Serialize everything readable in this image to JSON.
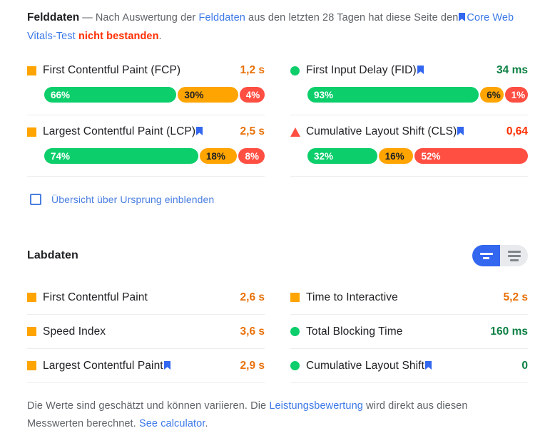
{
  "field_section": {
    "title": "Felddaten",
    "dash": "—",
    "sentence_part1": "Nach Auswertung der",
    "link1": "Felddaten",
    "sentence_part2": "aus den letzten 28 Tagen hat diese Seite den",
    "link2": "Core Web Vitals-Test",
    "fail_text": "nicht bestanden",
    "period": ".",
    "bookmark_icon": "bookmark-icon",
    "metrics": [
      {
        "id": "fcp",
        "label": "First Contentful Paint (FCP)",
        "value": "1,2 s",
        "status": "average",
        "glyph": "square-icon",
        "has_bookmark": false,
        "distribution": [
          {
            "label": "66%",
            "pct": 66,
            "band": "good"
          },
          {
            "label": "30%",
            "pct": 30,
            "band": "average"
          },
          {
            "label": "4%",
            "pct": 4,
            "band": "poor"
          }
        ]
      },
      {
        "id": "fid",
        "label": "First Input Delay (FID)",
        "value": "34 ms",
        "status": "good",
        "glyph": "circle-icon",
        "has_bookmark": true,
        "distribution": [
          {
            "label": "93%",
            "pct": 93,
            "band": "good"
          },
          {
            "label": "6%",
            "pct": 6,
            "band": "average"
          },
          {
            "label": "1%",
            "pct": 1,
            "band": "poor"
          }
        ]
      },
      {
        "id": "lcp",
        "label": "Largest Contentful Paint (LCP)",
        "value": "2,5 s",
        "status": "average",
        "glyph": "square-icon",
        "has_bookmark": true,
        "distribution": [
          {
            "label": "74%",
            "pct": 74,
            "band": "good"
          },
          {
            "label": "18%",
            "pct": 18,
            "band": "average"
          },
          {
            "label": "8%",
            "pct": 8,
            "band": "poor"
          }
        ]
      },
      {
        "id": "cls",
        "label": "Cumulative Layout Shift (CLS)",
        "value": "0,64",
        "status": "poor",
        "glyph": "triangle-icon",
        "has_bookmark": true,
        "distribution": [
          {
            "label": "32%",
            "pct": 32,
            "band": "good"
          },
          {
            "label": "16%",
            "pct": 16,
            "band": "average"
          },
          {
            "label": "52%",
            "pct": 52,
            "band": "poor"
          }
        ]
      }
    ],
    "origin_checkbox": {
      "label": "Übersicht über Ursprung einblenden",
      "checked": false
    }
  },
  "lab_section": {
    "title": "Labdaten",
    "view_toggle": {
      "active": "compact-view",
      "options": [
        {
          "id": "compact-view",
          "icon": "compact-list-icon",
          "active": true
        },
        {
          "id": "detailed-view",
          "icon": "detailed-list-icon",
          "active": false
        }
      ]
    },
    "metrics": [
      {
        "id": "fcp",
        "label": "First Contentful Paint",
        "value": "2,6 s",
        "status": "average",
        "glyph": "square-icon",
        "has_bookmark": false
      },
      {
        "id": "tti",
        "label": "Time to Interactive",
        "value": "5,2 s",
        "status": "average",
        "glyph": "square-icon",
        "has_bookmark": false
      },
      {
        "id": "si",
        "label": "Speed Index",
        "value": "3,6 s",
        "status": "average",
        "glyph": "square-icon",
        "has_bookmark": false
      },
      {
        "id": "tbt",
        "label": "Total Blocking Time",
        "value": "160 ms",
        "status": "good",
        "glyph": "circle-icon",
        "has_bookmark": false
      },
      {
        "id": "lcp",
        "label": "Largest Contentful Paint",
        "value": "2,9 s",
        "status": "average",
        "glyph": "square-icon",
        "has_bookmark": true
      },
      {
        "id": "cls",
        "label": "Cumulative Layout Shift",
        "value": "0",
        "status": "good",
        "glyph": "circle-icon",
        "has_bookmark": true
      }
    ]
  },
  "footer": {
    "part1": "Die Werte sind geschätzt und können variieren. Die",
    "link1": "Leistungsbewertung",
    "part2": "wird direkt aus diesen Messwerten berechnet.",
    "link2": "See calculator",
    "period": "."
  },
  "colors": {
    "good": "#0cce6b",
    "average": "#ffa400",
    "poor": "#ff4e42",
    "good_text": "#0b8043",
    "average_text": "#e8710a",
    "poor_text": "#ff2d00",
    "link": "#3b78e7",
    "accent": "#3367f0"
  }
}
